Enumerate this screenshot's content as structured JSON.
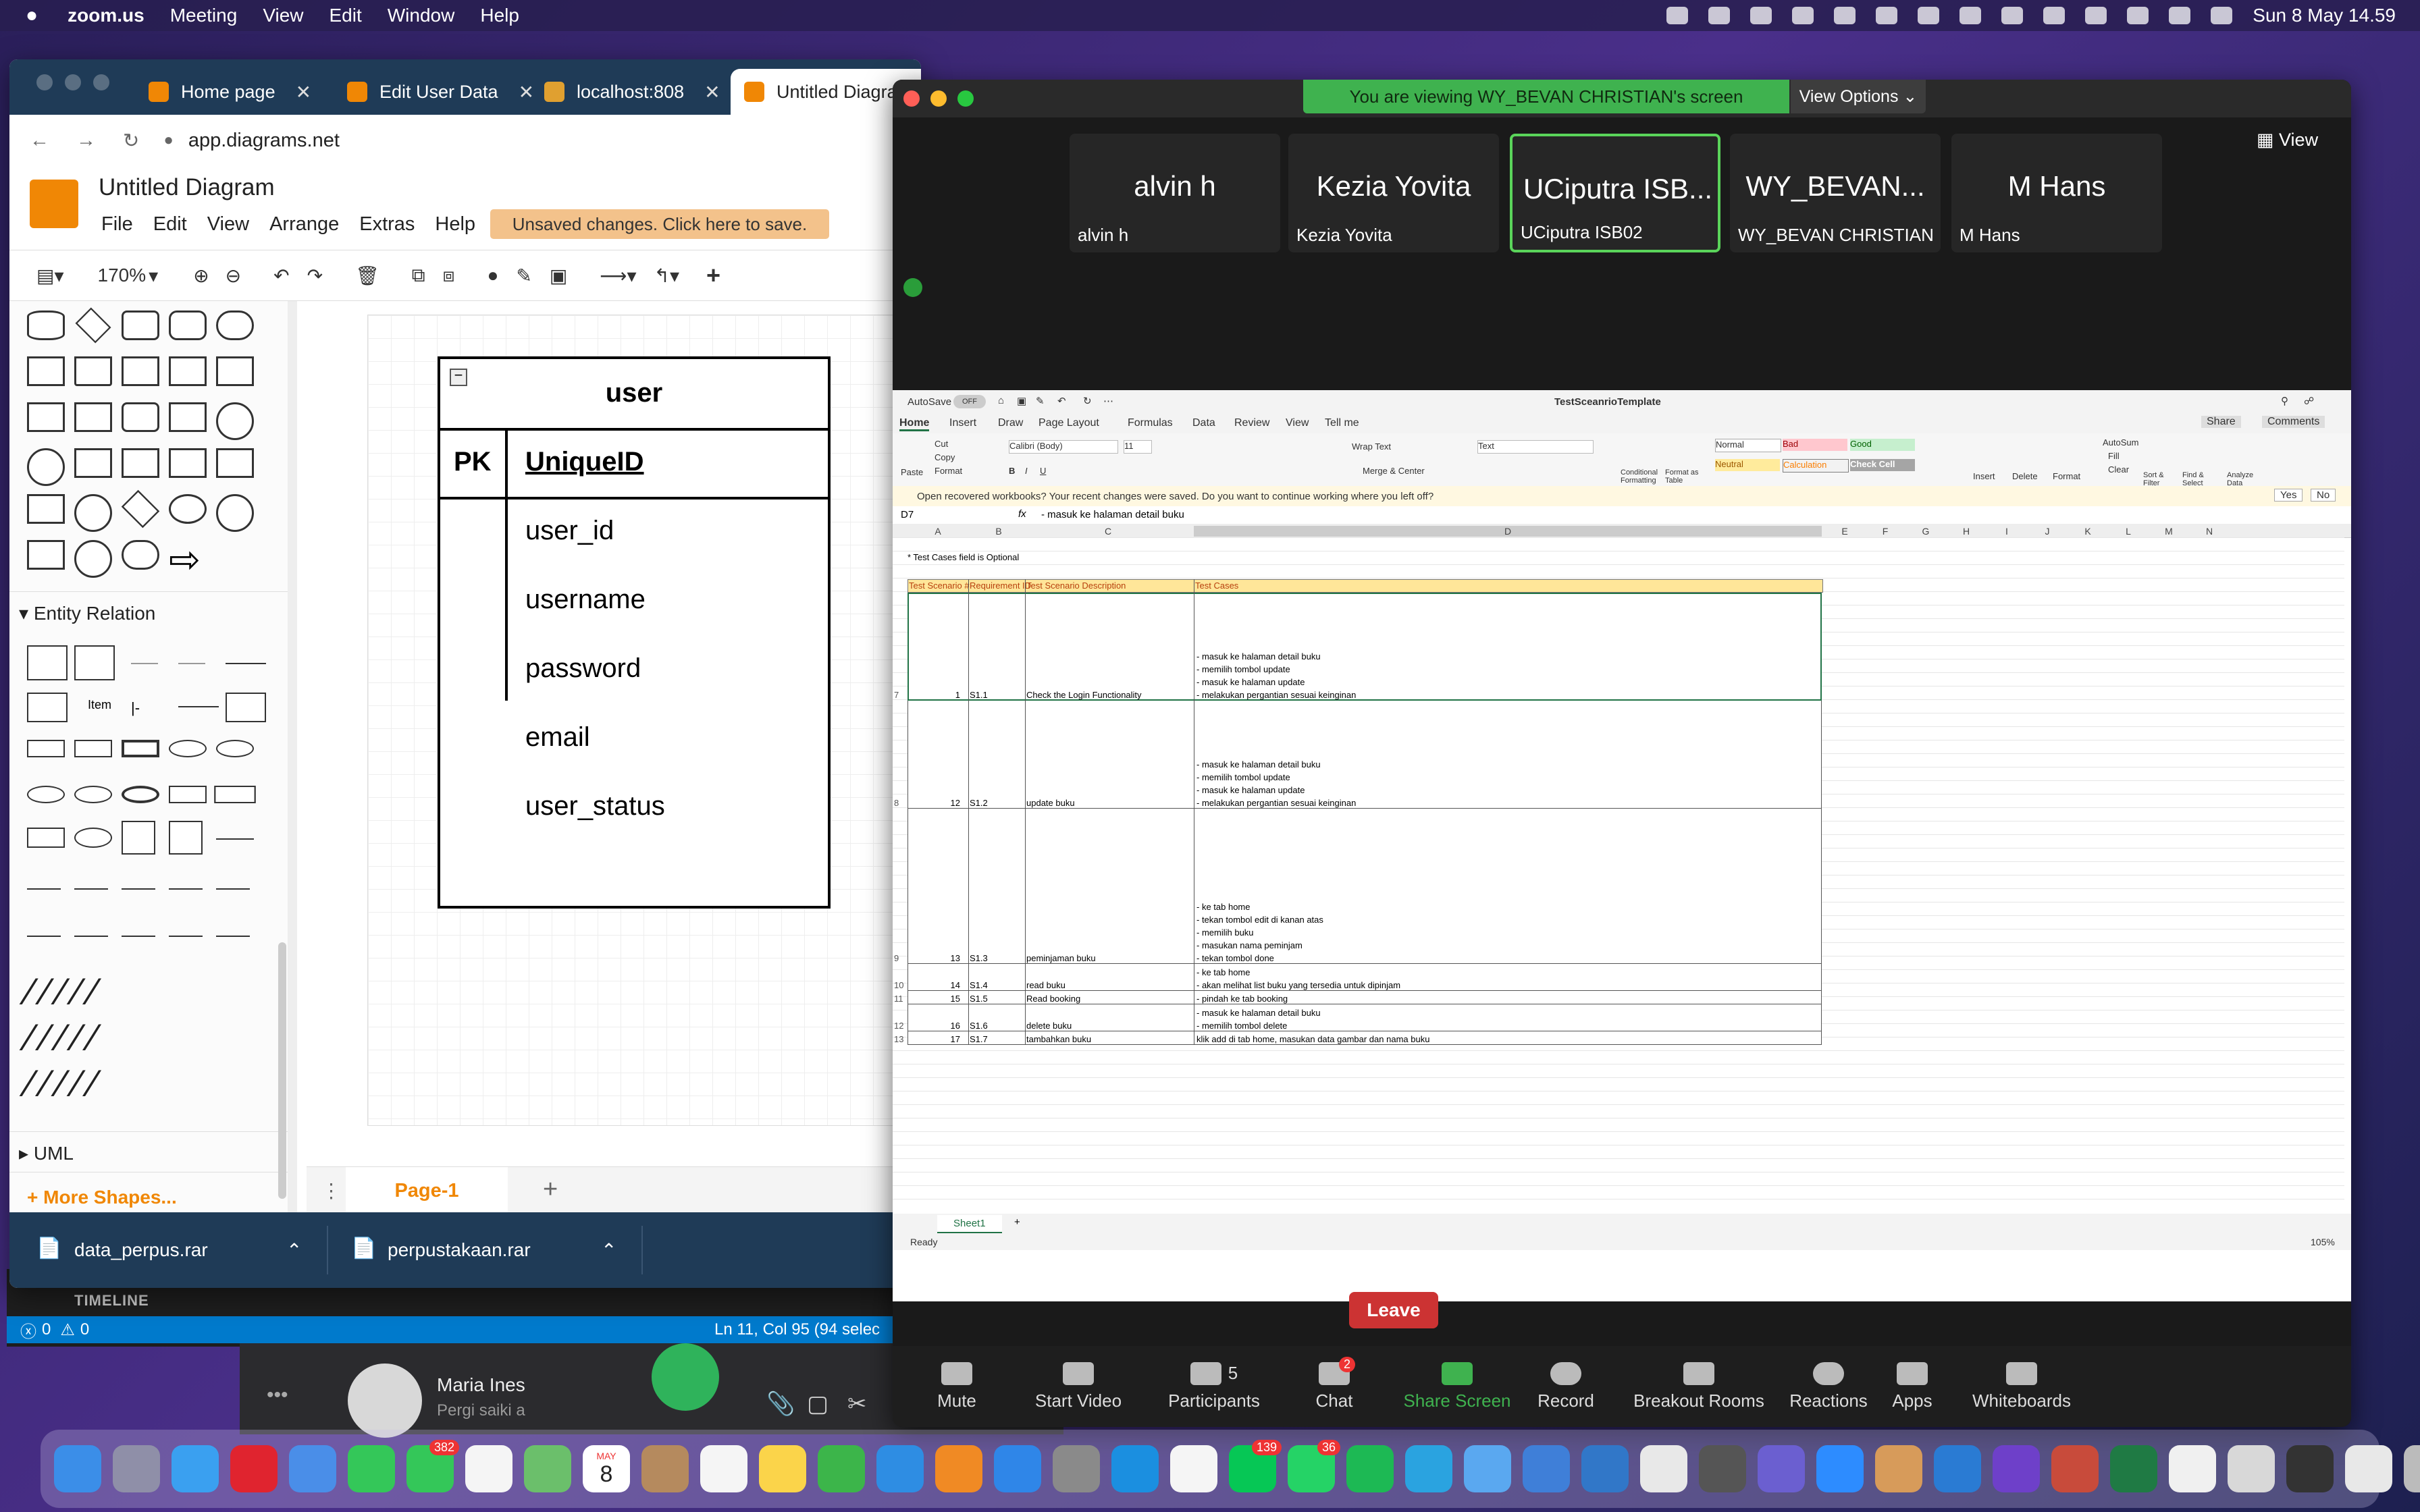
{
  "menubar": {
    "app": "zoom.us",
    "items": [
      "Meeting",
      "View",
      "Edit",
      "Window",
      "Help"
    ],
    "clock": "Sun 8 May  14.59"
  },
  "browser": {
    "tabs": [
      {
        "label": "Home page"
      },
      {
        "label": "Edit User Data"
      },
      {
        "label": "localhost:808"
      },
      {
        "label": "Untitled Diagra"
      }
    ],
    "url": "app.diagrams.net"
  },
  "drawio": {
    "title": "Untitled Diagram",
    "menu": [
      "File",
      "Edit",
      "View",
      "Arrange",
      "Extras",
      "Help"
    ],
    "unsaved": "Unsaved changes. Click here to save.",
    "zoom": "170%",
    "section_entity": "Entity Relation",
    "section_uml": "UML",
    "more_shapes": "+ More Shapes...",
    "item_label": "Item",
    "page_tab": "Page-1",
    "table": {
      "name": "user",
      "pk_label": "PK",
      "pk_field": "UniqueID",
      "fields": [
        "user_id",
        "username",
        "password",
        "email",
        "user_status"
      ]
    }
  },
  "downloads": [
    "data_perpus.rar",
    "perpustakaan.rar"
  ],
  "vscode": {
    "timeline": "TIMELINE",
    "errors": "0",
    "warnings": "0",
    "position": "Ln 11, Col 95 (94 selec"
  },
  "line_chat": {
    "name": "Maria Ines",
    "message": "Pergi saiki a"
  },
  "zoom": {
    "banner": "You are viewing WY_BEVAN CHRISTIAN's screen",
    "view_options": "View Options",
    "view_button": "View",
    "participants": [
      {
        "big": "alvin h",
        "small": "alvin h"
      },
      {
        "big": "Kezia Yovita",
        "small": "Kezia Yovita"
      },
      {
        "big": "UCiputra ISB...",
        "small": "UCiputra ISB02"
      },
      {
        "big": "WY_BEVAN...",
        "small": "WY_BEVAN CHRISTIAN"
      },
      {
        "big": "M Hans",
        "small": "M Hans"
      }
    ],
    "controls": [
      "Mute",
      "Start Video",
      "Participants",
      "Chat",
      "Share Screen",
      "Record",
      "Breakout Rooms",
      "Reactions",
      "Apps",
      "Whiteboards"
    ],
    "participants_count": "5",
    "chat_badge": "2",
    "leave": "Leave"
  },
  "excel": {
    "autosave": "AutoSave",
    "autosave_state": "OFF",
    "filename": "TestSceanrioTemplate",
    "tabs": [
      "Home",
      "Insert",
      "Draw",
      "Page Layout",
      "Formulas",
      "Data",
      "Review",
      "View",
      "Tell me"
    ],
    "share": "Share",
    "comments": "Comments",
    "font": "Calibri (Body)",
    "font_size": "11",
    "wrap_text": "Wrap Text",
    "number_format": "Text",
    "merge": "Merge & Center",
    "styles": [
      "Normal",
      "Bad",
      "Good",
      "Neutral",
      "Calculation",
      "Check Cell"
    ],
    "ribbon_right": [
      "Insert",
      "Delete",
      "Format",
      "Sort & Filter",
      "Find & Select",
      "Analyze Data"
    ],
    "paste": "Paste",
    "clipboard": [
      "Cut",
      "Copy",
      "Format"
    ],
    "conditional": "Conditional Formatting",
    "format_table": "Format as Table",
    "autosum": "AutoSum",
    "fill": "Fill",
    "clear": "Clear",
    "recovered_msg": "Open recovered workbooks?  Your recent changes were saved. Do you want to continue working where you left off?",
    "yes": "Yes",
    "no": "No",
    "cell_ref": "D7",
    "formula": "- masuk ke halaman detail buku",
    "columns": [
      "A",
      "B",
      "C",
      "D",
      "E",
      "F",
      "G",
      "H",
      "I",
      "J",
      "K",
      "L",
      "M",
      "N"
    ],
    "note": "* Test Cases field is Optional",
    "headers": [
      "Test Scenario #",
      "Requirement ID",
      "Test Scenario Description",
      "Test Cases"
    ],
    "rows": [
      {
        "row": "7",
        "num": "1",
        "req": "S1.1",
        "desc": "Check the Login Functionality",
        "cases": [
          "- masuk ke halaman detail buku",
          "- memilih tombol update",
          "- masuk ke halaman update",
          "- melakukan pergantian sesuai keinginan"
        ]
      },
      {
        "row": "8",
        "num": "12",
        "req": "S1.2",
        "desc": "update buku",
        "cases": [
          "- masuk ke halaman detail buku",
          "- memilih tombol update",
          "- masuk ke halaman update",
          "- melakukan pergantian sesuai keinginan"
        ]
      },
      {
        "row": "9",
        "num": "13",
        "req": "S1.3",
        "desc": "peminjaman buku",
        "cases": [
          "- ke tab home",
          "- tekan tombol edit di kanan atas",
          "- memilih buku",
          "- masukan nama peminjam",
          "- tekan tombol done"
        ]
      },
      {
        "row": "10",
        "num": "14",
        "req": "S1.4",
        "desc": "read buku",
        "cases": [
          "- ke tab home",
          "- akan melihat list buku yang tersedia untuk dipinjam"
        ]
      },
      {
        "row": "11",
        "num": "15",
        "req": "S1.5",
        "desc": "Read booking",
        "cases": [
          "- pindah ke tab booking"
        ]
      },
      {
        "row": "12",
        "num": "16",
        "req": "S1.6",
        "desc": "delete buku",
        "cases": [
          "- masuk ke halaman detail buku",
          "- memilih tombol delete"
        ]
      },
      {
        "row": "13",
        "num": "17",
        "req": "S1.7",
        "desc": "tambahkan buku",
        "cases": [
          "klik add di tab home, masukan data gambar dan nama buku"
        ]
      }
    ],
    "sheet": "Sheet1",
    "status": "Ready",
    "zoom": "105%"
  },
  "dock_badges": {
    "messages": "382",
    "calendar_month": "MAY",
    "calendar_day": "8",
    "line": "139",
    "whatsapp": "36"
  }
}
